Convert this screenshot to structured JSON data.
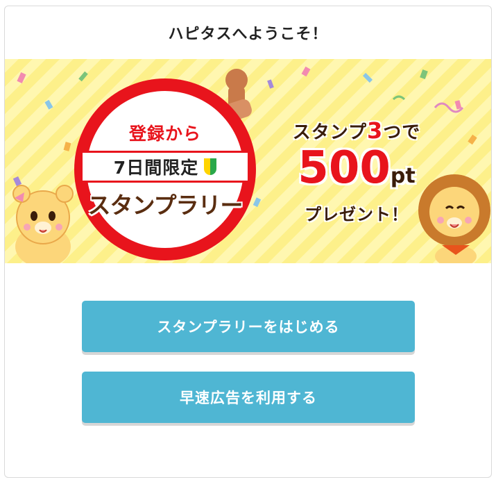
{
  "modal": {
    "title": "ハピタスへようこそ！"
  },
  "banner": {
    "stamp_top_text": "登録から",
    "stamp_band_text": "7日間限定",
    "rally_title": "スタンプラリー",
    "promo_line1_pre": "スタンプ",
    "promo_line1_num": "3",
    "promo_line1_post": "つで",
    "promo_amount": "500",
    "promo_unit": "pt",
    "promo_line3": "プレゼント！"
  },
  "buttons": {
    "start_label": "スタンプラリーをはじめる",
    "ads_label": "早速広告を利用する"
  },
  "colors": {
    "button": "#4fb6d3",
    "stamp_red": "#e8141c",
    "banner_yellow": "#fff7b0",
    "title_brown": "#5a2d10"
  }
}
